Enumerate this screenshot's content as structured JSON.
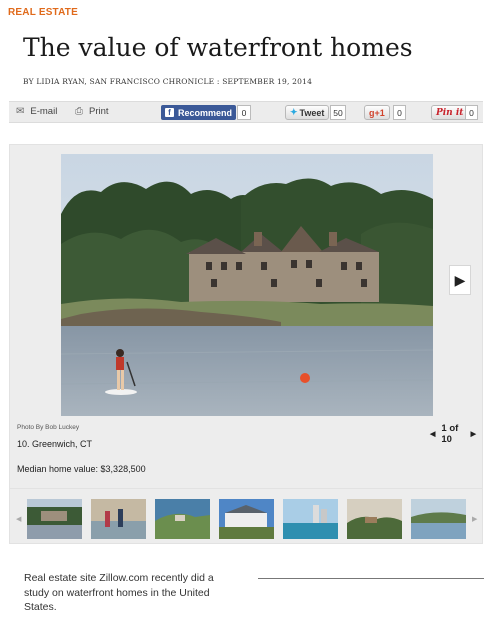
{
  "section": {
    "label": "REAL ESTATE",
    "color": "#e06a1b"
  },
  "article": {
    "headline": "The value of waterfront homes",
    "byline": "BY LIDIA RYAN, SAN FRANCISCO CHRONICLE : SEPTEMBER 19, 2014",
    "body_text": "Real estate site Zillow.com recently did a study on waterfront homes in the United States."
  },
  "share": {
    "email_label": "E-mail",
    "email_icon": "envelope-icon",
    "print_label": "Print",
    "print_icon": "printer-icon",
    "facebook_label": "Recommend",
    "facebook_count": "0",
    "twitter_label": "Tweet",
    "twitter_count": "50",
    "google_label": "+1",
    "google_count": "0",
    "pinterest_label": "Pin it",
    "pinterest_count": "0"
  },
  "gallery": {
    "photo_credit": "Photo By Bob Luckey",
    "counter": "1 of 10",
    "caption_title": "10. Greenwich, CT",
    "caption_value": "Median home value: $3,328,500",
    "next_icon": "play-right-icon",
    "prev_icon": "caret-left-icon",
    "thumbnail_count": 7
  }
}
